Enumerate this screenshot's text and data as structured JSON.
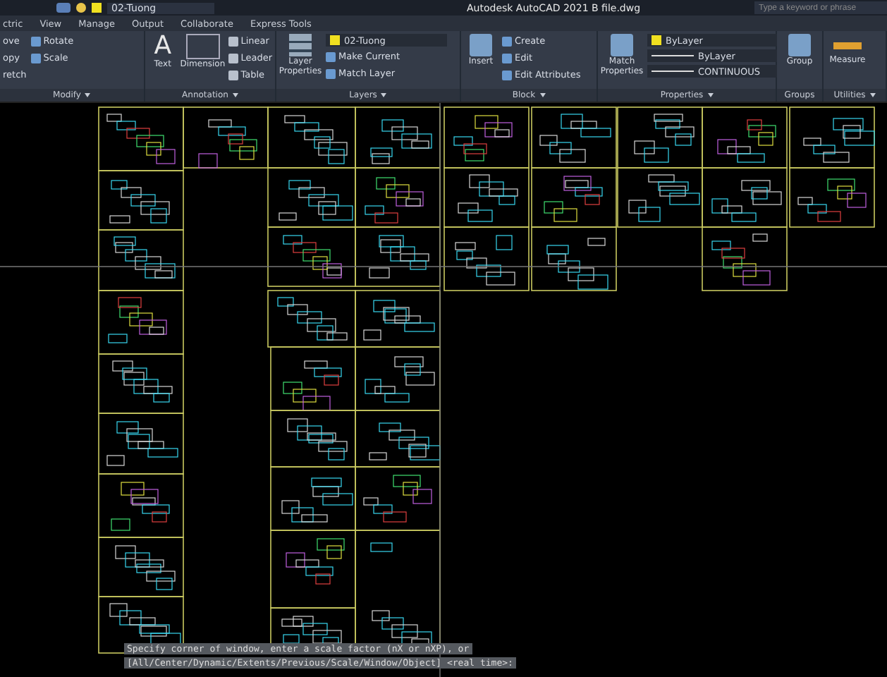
{
  "quick_access": {
    "layer": "02-Tuong"
  },
  "title": "Autodesk AutoCAD 2021   B file.dwg",
  "search": {
    "placeholder": "Type a keyword or phrase"
  },
  "tabs": [
    {
      "label": "ctric",
      "selected": false
    },
    {
      "label": "View",
      "selected": false
    },
    {
      "label": "Manage",
      "selected": false
    },
    {
      "label": "Output",
      "selected": false
    },
    {
      "label": "Collaborate",
      "selected": false
    },
    {
      "label": "Express Tools",
      "selected": false
    }
  ],
  "modify": {
    "title": "Modify",
    "tools": [
      "ove",
      "opy",
      "retch"
    ],
    "tools_2": [
      "Rotate",
      "Scale"
    ]
  },
  "annotation": {
    "title": "Annotation",
    "big": [
      "Text",
      "Dimension"
    ],
    "text_icon": "A",
    "small": [
      "Linear",
      "Leader",
      "Table"
    ]
  },
  "layers": {
    "title": "Layers",
    "big": "Layer Properties",
    "current": "02-Tuong",
    "small": [
      "Make Current",
      "Match Layer"
    ]
  },
  "block": {
    "title": "Block",
    "big": "Insert",
    "small": [
      "Create",
      "Edit",
      "Edit Attributes"
    ]
  },
  "properties": {
    "title": "Properties",
    "big": "Match Properties",
    "rows": [
      "ByLayer",
      "ByLayer",
      "CONTINUOUS"
    ]
  },
  "groups": {
    "title": "Groups",
    "big": "Group"
  },
  "utilities": {
    "title": "Utilities",
    "big": "Measure"
  },
  "command_line": [
    "Specify corner of window, enter a scale factor (nX or nXP), or",
    "[All/Center/Dynamic/Extents/Previous/Scale/Window/Object] <real time>:"
  ]
}
